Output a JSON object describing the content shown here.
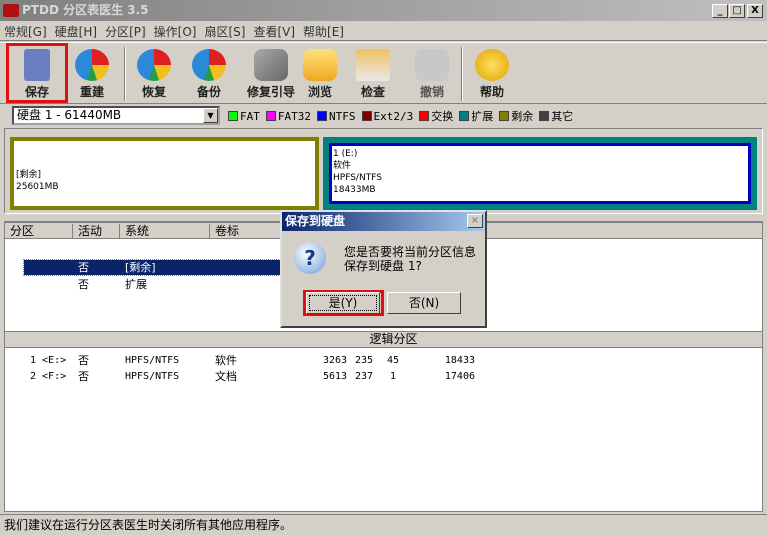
{
  "window": {
    "title": "PTDD 分区表医生 3.5",
    "min": "_",
    "max": "□",
    "close": "X"
  },
  "menu": [
    "常规[G]",
    "硬盘[H]",
    "分区[P]",
    "操作[O]",
    "扇区[S]",
    "查看[V]",
    "帮助[E]"
  ],
  "toolbar": {
    "save": "保存",
    "rebuild": "重建",
    "restore": "恢复",
    "backup": "备份",
    "repair_boot": "修复引导",
    "browse": "浏览",
    "check": "检查",
    "undo": "撤销",
    "help": "帮助"
  },
  "disk": {
    "selected": "硬盘 1 - 61440MB"
  },
  "legend": [
    {
      "label": "FAT",
      "color": "#00ff00"
    },
    {
      "label": "FAT32",
      "color": "#ff00ff"
    },
    {
      "label": "NTFS",
      "color": "#0000ff"
    },
    {
      "label": "Ext2/3",
      "color": "#800000"
    },
    {
      "label": "交换",
      "color": "#ff0000"
    },
    {
      "label": "扩展",
      "color": "#008080"
    },
    {
      "label": "剩余",
      "color": "#808000"
    },
    {
      "label": "其它",
      "color": "#404040"
    }
  ],
  "map": {
    "free": {
      "label": "[剩余]",
      "size": "25601MB"
    },
    "part1": {
      "name": "1 (E:)",
      "label": "软件",
      "fs": "HPFS/NTFS",
      "size": "18433MB"
    }
  },
  "list": {
    "headers": [
      "分区",
      "活动",
      "系统",
      "卷标"
    ],
    "primary_rows": [
      {
        "active": "否",
        "system": "[剩余]"
      },
      {
        "active": "否",
        "system": "扩展"
      }
    ],
    "logical_header": "逻辑分区",
    "logical_rows": [
      {
        "part": "1 <E:>",
        "active": "否",
        "system": "HPFS/NTFS",
        "label": "软件",
        "c": "3263",
        "h": "235",
        "s": "45",
        "size": "18433"
      },
      {
        "part": "2 <F:>",
        "active": "否",
        "system": "HPFS/NTFS",
        "label": "文档",
        "c": "5613",
        "h": "237",
        "s": "1",
        "size": "17406"
      }
    ]
  },
  "dialog": {
    "title": "保存到硬盘",
    "line1": "您是否要将当前分区信息",
    "line2": "保存到硬盘 1?",
    "yes": "是(Y)",
    "no": "否(N)",
    "close": "×"
  },
  "status": "我们建议在运行分区表医生时关闭所有其他应用程序。"
}
